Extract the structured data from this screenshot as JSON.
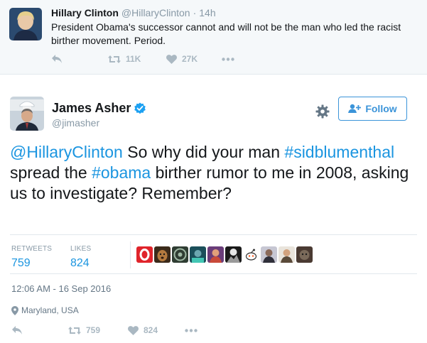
{
  "quoted_tweet": {
    "name": "Hillary Clinton",
    "handle": "@HillaryClinton",
    "separator": "·",
    "time": "14h",
    "text": "President Obama's successor cannot and will not be the man who led the racist birther movement. Period.",
    "retweets": "11K",
    "likes": "27K"
  },
  "main_tweet": {
    "name": "James Asher",
    "handle": "@jimasher",
    "follow_label": "Follow",
    "text_parts": {
      "mention": "@HillaryClinton",
      "part1": " So why did your man ",
      "hashtag1": "#sidblumenthal",
      "part2": " spread the ",
      "hashtag2": "#obama",
      "part3": " birther rumor to me in 2008, asking us to investigate? Remember?"
    },
    "stats": {
      "retweets_label": "RETWEETS",
      "retweets_value": "759",
      "likes_label": "LIKES",
      "likes_value": "824"
    },
    "timestamp": "12:06 AM - 16 Sep 2016",
    "location": "Maryland, USA",
    "action_retweets": "759",
    "action_likes": "824"
  },
  "colors": {
    "link": "#1b95e0",
    "muted": "#8899a6",
    "action_icon": "#aab8c2",
    "verified": "#1da1f2",
    "follow_border": "#3b94d9"
  },
  "icons": [
    "reply-icon",
    "retweet-icon",
    "heart-icon",
    "more-icon",
    "verified-badge-icon",
    "gear-icon",
    "add-user-icon",
    "location-pin-icon"
  ]
}
